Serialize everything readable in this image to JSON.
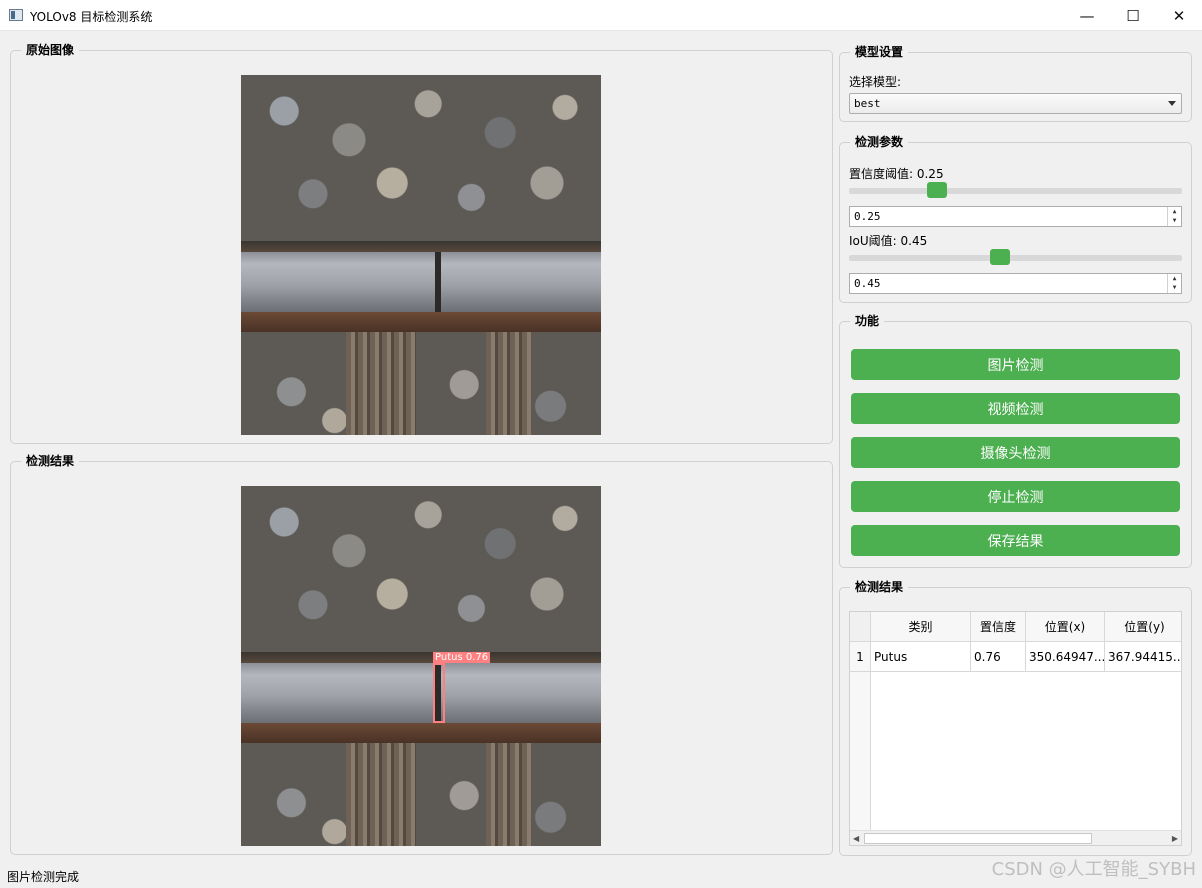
{
  "window": {
    "title": "YOLOv8 目标检测系统",
    "minimize_glyph": "—",
    "maximize_glyph": "☐",
    "close_glyph": "✕"
  },
  "original_panel": {
    "title": "原始图像"
  },
  "result_panel": {
    "title": "检测结果"
  },
  "detection_overlay": {
    "label": "Putus  0.76",
    "color": "#ff8080"
  },
  "model_settings": {
    "title": "模型设置",
    "select_label": "选择模型:",
    "selected_model": "best"
  },
  "detection_params": {
    "title": "检测参数",
    "confidence_label": "置信度阈值: 0.25",
    "confidence_value": "0.25",
    "confidence": 0.25,
    "iou_label": "IoU阈值: 0.45",
    "iou_value": "0.45",
    "iou": 0.45
  },
  "functions": {
    "title": "功能",
    "image_detect": "图片检测",
    "video_detect": "视频检测",
    "camera_detect": "摄像头检测",
    "stop_detect": "停止检测",
    "save_result": "保存结果",
    "button_color": "#4caf50"
  },
  "results": {
    "title": "检测结果",
    "columns": [
      "类别",
      "置信度",
      "位置(x)",
      "位置(y)"
    ],
    "rows": [
      {
        "index": "1",
        "class": "Putus",
        "confidence": "0.76",
        "x": "350.64947...",
        "y": "367.94415..."
      }
    ]
  },
  "status": {
    "text": "图片检测完成"
  },
  "watermark": {
    "text": "CSDN @人工智能_SYBH"
  }
}
